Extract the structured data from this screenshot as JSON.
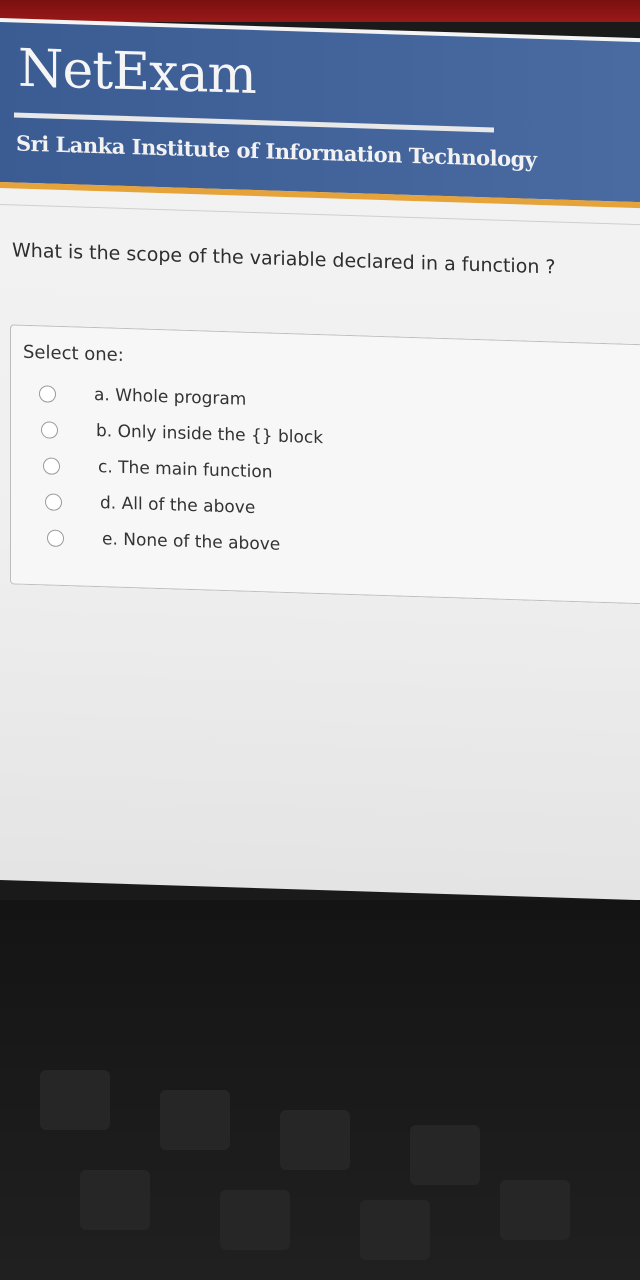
{
  "app": {
    "logo": "NetExam",
    "institute": "Sri Lanka Institute of Information Technology"
  },
  "question": {
    "text": "What is the scope of the variable declared in a function ?"
  },
  "answers": {
    "prompt": "Select one:",
    "options": [
      {
        "label": "a. Whole program",
        "selected": false
      },
      {
        "label": "b. Only inside the {} block",
        "selected": false
      },
      {
        "label": "c. The main function",
        "selected": false
      },
      {
        "label": "d. All of the above",
        "selected": false
      },
      {
        "label": "e. None of the above",
        "selected": false
      }
    ]
  },
  "colors": {
    "banner": "#3b5c93",
    "accent_line": "#e5a33a",
    "page": "#f4f4f4"
  }
}
